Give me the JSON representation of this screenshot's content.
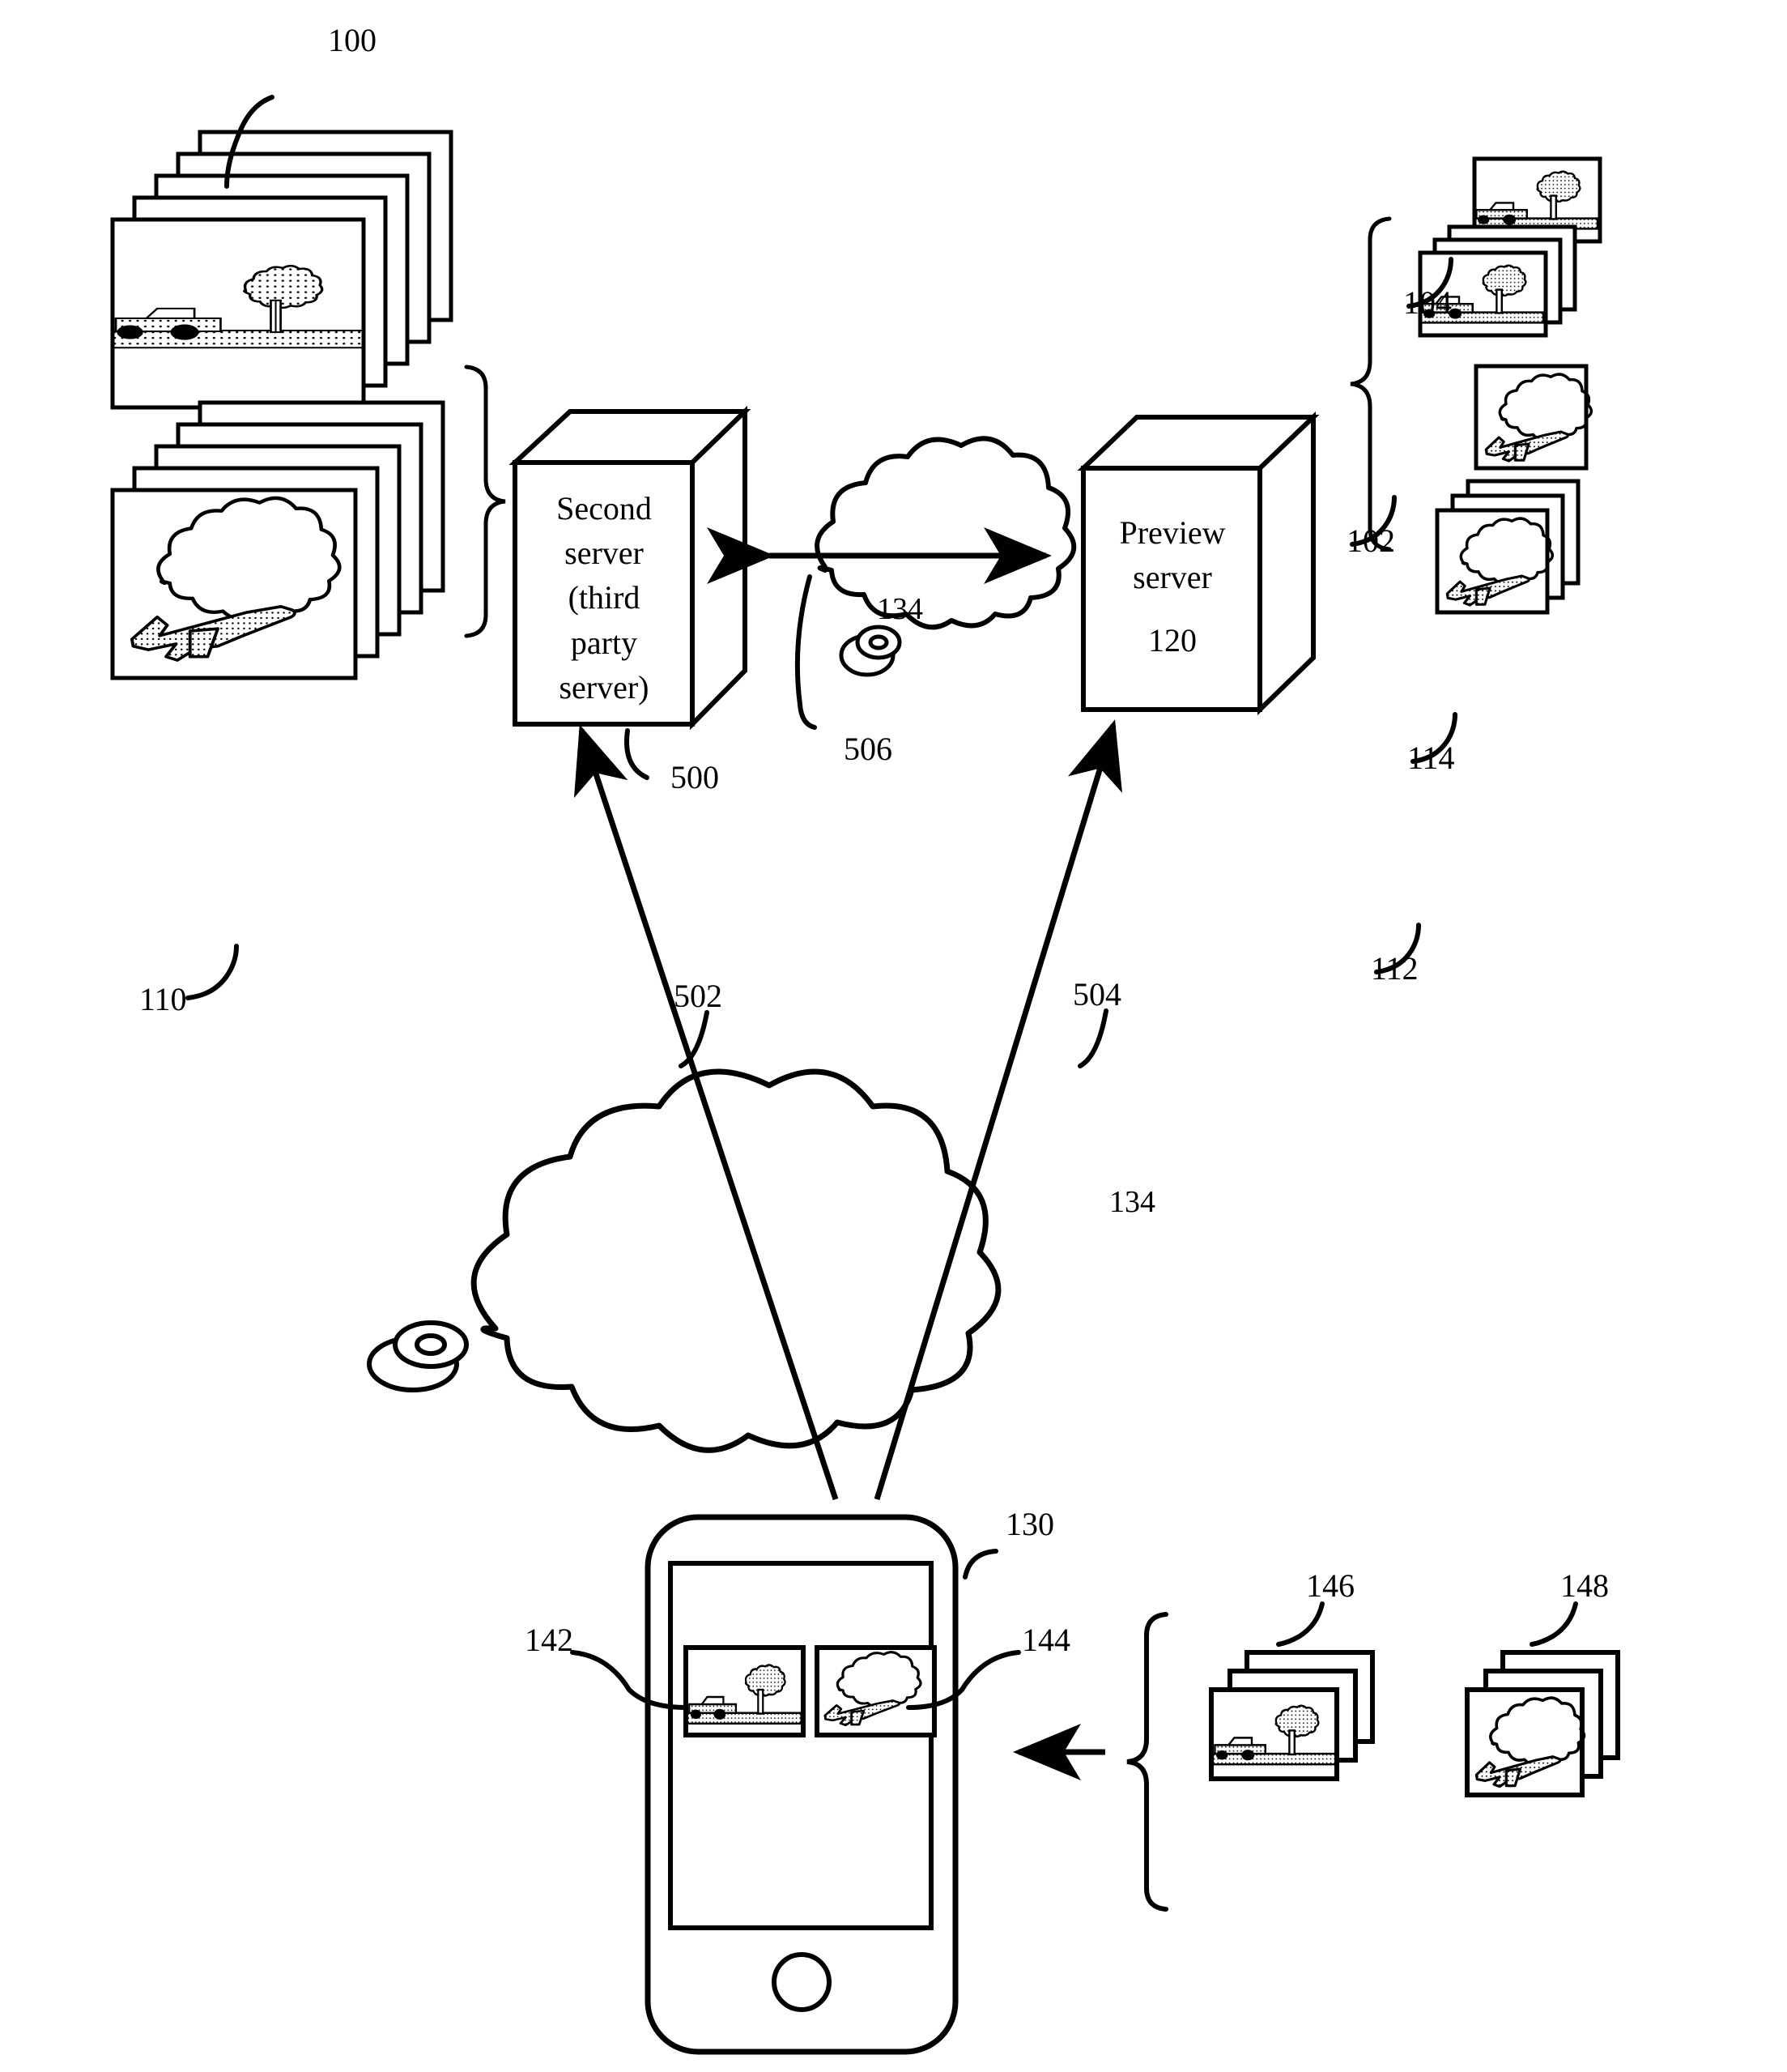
{
  "figure": {
    "type": "patent-system-diagram",
    "background": "#ffffff",
    "stroke": "#000000"
  },
  "nodes": {
    "second_server": {
      "label": "Second\nserver\n(third\nparty\nserver)",
      "ref": "500"
    },
    "preview_server": {
      "label": "Preview\nserver",
      "number": "120"
    },
    "small_cloud": {
      "label": "134",
      "ref": "506"
    },
    "big_cloud": {
      "label": "134"
    },
    "phone": {
      "ref": "130",
      "left_thumb_ref": "142",
      "right_thumb_ref": "144"
    }
  },
  "image_stacks": {
    "source_car": {
      "ref": "100",
      "sheets": 5,
      "scene": "car-and-tree"
    },
    "source_plane": {
      "ref": "110",
      "sheets": 5,
      "scene": "plane-and-cloud"
    },
    "right_car_single": {
      "ref": "104",
      "sheets": 1,
      "scene": "car-and-tree"
    },
    "right_car_stack": {
      "ref": "102",
      "sheets": 3,
      "scene": "car-and-tree"
    },
    "right_plane_single": {
      "ref": "114",
      "sheets": 1,
      "scene": "plane-and-cloud"
    },
    "right_plane_stack": {
      "ref": "112",
      "sheets": 3,
      "scene": "plane-and-cloud"
    },
    "device_car_stack": {
      "ref": "146",
      "sheets": 3,
      "scene": "car-and-tree"
    },
    "device_plane_stack": {
      "ref": "148",
      "sheets": 3,
      "scene": "plane-and-cloud"
    }
  },
  "connectors": {
    "server_to_preview": {
      "ref": "506",
      "style": "double-arrow-through-cloud"
    },
    "phone_to_second_server": {
      "ref": "502",
      "style": "single-arrow-up"
    },
    "phone_to_preview_server": {
      "ref": "504",
      "style": "single-arrow-up"
    },
    "stacks_to_phone": {
      "style": "single-arrow-left"
    }
  },
  "labels": {
    "n100": "100",
    "n110": "110",
    "n104": "104",
    "n102": "102",
    "n114": "114",
    "n112": "112",
    "n130": "130",
    "n142": "142",
    "n144": "144",
    "n146": "146",
    "n148": "148",
    "n500": "500",
    "n502": "502",
    "n504": "504",
    "n506": "506",
    "n120": "120",
    "n134_small": "134",
    "n134_big": "134",
    "second_server_text": "Second\nserver\n(third\nparty\nserver)",
    "preview_server_text": "Preview\nserver"
  }
}
